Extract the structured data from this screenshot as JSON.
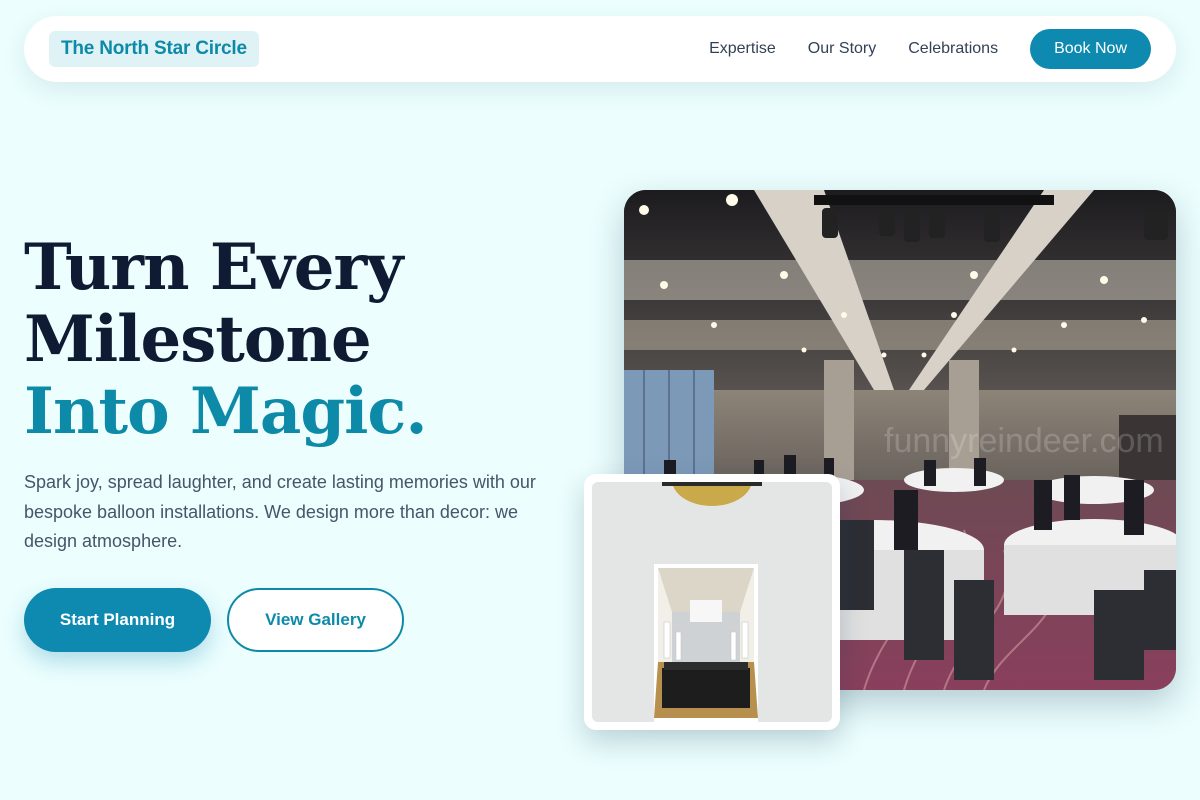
{
  "nav": {
    "brand": "The North Star Circle",
    "links": [
      "Expertise",
      "Our Story",
      "Celebrations"
    ],
    "cta": "Book Now"
  },
  "hero": {
    "title_line1": "Turn Every",
    "title_line2": "Milestone",
    "title_line3": "Into Magic.",
    "subtitle": "Spark joy, spread laughter, and create lasting memories with our bespoke balloon installations. We design more than decor: we design atmosphere.",
    "primary_button": "Start Planning",
    "secondary_button": "View Gallery"
  },
  "images": {
    "main_watermark": "funnyreindeer.com",
    "main_icon": "ballroom-photo",
    "thumb_icon": "hallway-photo"
  },
  "colors": {
    "accent": "#0e8aa9",
    "button": "#0e8ab0",
    "background": "#ecfefe",
    "heading": "#0f1a33",
    "body_text": "#475569"
  }
}
